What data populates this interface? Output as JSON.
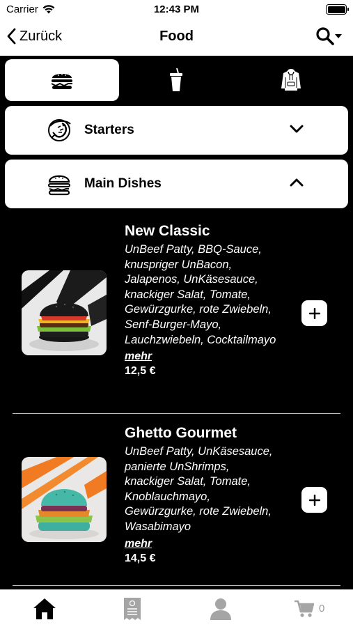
{
  "status_bar": {
    "carrier": "Carrier",
    "time": "12:43 PM"
  },
  "nav": {
    "back_label": "Zurück",
    "title": "Food"
  },
  "tabs": [
    {
      "icon": "burger-icon",
      "active": true
    },
    {
      "icon": "drink-cup-icon",
      "active": false
    },
    {
      "icon": "hoodie-icon",
      "active": false
    }
  ],
  "sections": [
    {
      "label": "Starters",
      "icon": "shrimp-icon",
      "expanded": false
    },
    {
      "label": "Main Dishes",
      "icon": "burger-icon",
      "expanded": true
    }
  ],
  "items": [
    {
      "name": "New Classic",
      "description": "UnBeef Patty, BBQ-Sauce, knuspriger UnBacon, Jalapenos, UnKäsesauce, knackiger Salat, Tomate, Gewürzgurke, rote Zwiebeln, Senf-Burger-Mayo, Lauchzwiebeln, Cocktailmayo",
      "more_label": "mehr",
      "price": "12,5 €"
    },
    {
      "name": "Ghetto Gourmet",
      "description": "UnBeef Patty, UnKäsesauce, panierte UnShrimps, knackiger Salat, Tomate, Knoblauchmayo, Gewürzgurke, rote Zwiebeln, Wasabimayo",
      "more_label": "mehr",
      "price": "14,5 €"
    }
  ],
  "bottom_bar": {
    "items": [
      "home-icon",
      "receipt-icon",
      "profile-icon",
      "cart-icon"
    ],
    "active": "home-icon",
    "cart_count": "0"
  },
  "colors": {
    "background": "#000000",
    "surface": "#ffffff",
    "inactive_icon": "#9a9a9a"
  }
}
